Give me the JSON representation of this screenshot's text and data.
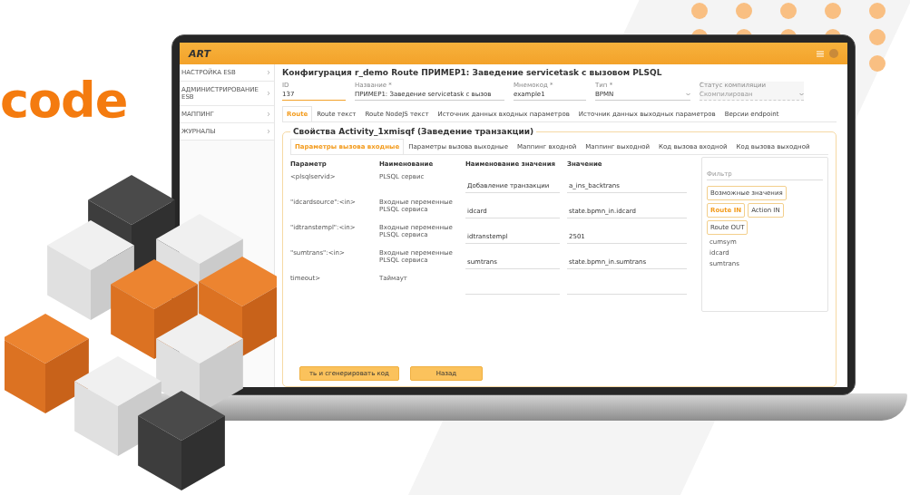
{
  "brand": {
    "text": "code"
  },
  "app": {
    "logo": "ART",
    "sidebar": {
      "items": [
        {
          "label": "НАСТРОЙКА ESB"
        },
        {
          "label": "АДМИНИСТРИРОВАНИЕ ESB"
        },
        {
          "label": "МАППИНГ"
        },
        {
          "label": "ЖУРНАЛЫ"
        }
      ]
    },
    "page_title": "Конфигурация r_demo Route ПРИМЕР1: Заведение servicetask с вызовом PLSQL",
    "fields": [
      {
        "label": "ID",
        "value": "137",
        "kind": "text",
        "focused": true,
        "disabled": false
      },
      {
        "label": "Название *",
        "value": "ПРИМЕР1: Заведение servicetask с вызов",
        "kind": "text",
        "focused": false,
        "disabled": false
      },
      {
        "label": "Мнемокод *",
        "value": "example1",
        "kind": "text",
        "focused": false,
        "disabled": false
      },
      {
        "label": "Тип *",
        "value": "BPMN",
        "kind": "select",
        "focused": false,
        "disabled": false
      },
      {
        "label": "Статус компиляции",
        "value": "Скомпилирован",
        "kind": "select",
        "focused": false,
        "disabled": true
      }
    ],
    "tabs": [
      {
        "label": "Route",
        "selected": true
      },
      {
        "label": "Route текст",
        "selected": false
      },
      {
        "label": "Route NodeJS текст",
        "selected": false
      },
      {
        "label": "Источник данных входных параметров",
        "selected": false
      },
      {
        "label": "Источник данных выходных параметров",
        "selected": false
      },
      {
        "label": "Версии endpoint",
        "selected": false
      }
    ],
    "section_title": "Свойства Activity_1xmisqf (Заведение транзакции)",
    "subtabs": [
      {
        "label": "Параметры вызова входные",
        "selected": true
      },
      {
        "label": "Параметры вызова выходные",
        "selected": false
      },
      {
        "label": "Маппинг входной",
        "selected": false
      },
      {
        "label": "Маппинг выходной",
        "selected": false
      },
      {
        "label": "Код вызова входной",
        "selected": false
      },
      {
        "label": "Код вызова выходной",
        "selected": false
      }
    ],
    "table": {
      "columns": [
        "Параметр",
        "Наименование",
        "Наименование значения",
        "Значение"
      ],
      "rows": [
        {
          "param": "<plsqlservid>",
          "name": "PLSQL сервис",
          "value_name": "Добавление транзакции",
          "value": "a_ins_backtrans"
        },
        {
          "param": "\"idcardsource\":<in>",
          "name": "Входные переменные PLSQL сервиса",
          "value_name": "idcard",
          "value": "state.bpmn_in.idcard"
        },
        {
          "param": "\"idtranstempl\":<in>",
          "name": "Входные переменные PLSQL сервиса",
          "value_name": "idtranstempl",
          "value": "2501"
        },
        {
          "param": "\"sumtrans\":<in>",
          "name": "Входные переменные PLSQL сервиса",
          "value_name": "sumtrans",
          "value": "state.bpmn_in.sumtrans"
        },
        {
          "param": "timeout>",
          "name": "Таймаут"
        }
      ]
    },
    "filter": {
      "placeholder": "Фильтр",
      "chips": [
        {
          "label": "Возможные значения",
          "selected": false
        },
        {
          "label": "Route IN",
          "selected": true
        },
        {
          "label": "Action IN",
          "selected": false
        },
        {
          "label": "Route OUT",
          "selected": false
        }
      ],
      "items": [
        "cumsym",
        "idcard",
        "sumtrans"
      ]
    },
    "buttons": [
      {
        "label": "ть и сгенерировать код"
      },
      {
        "label": "Назад"
      }
    ]
  }
}
